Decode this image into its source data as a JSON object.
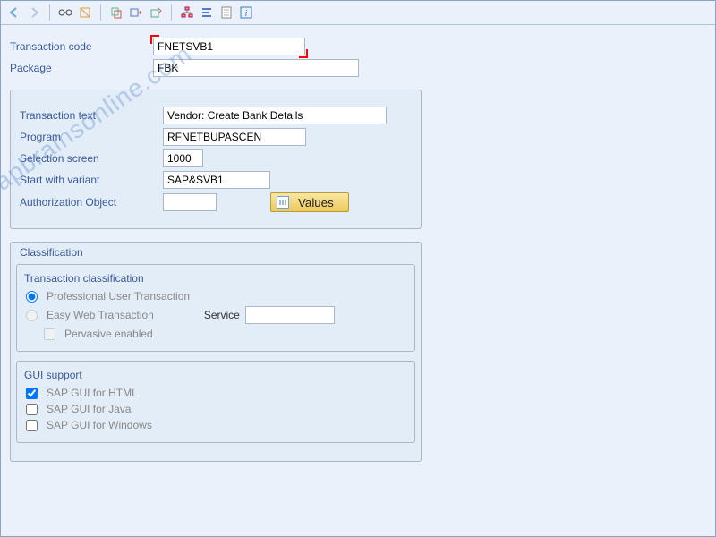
{
  "header": {
    "transaction_code_label": "Transaction code",
    "transaction_code_value": "FNETSVB1",
    "package_label": "Package",
    "package_value": "FBK"
  },
  "details": {
    "transaction_text_label": "Transaction text",
    "transaction_text_value": "Vendor: Create Bank Details",
    "program_label": "Program",
    "program_value": "RFNETBUPASCEN",
    "selection_screen_label": "Selection screen",
    "selection_screen_value": "1000",
    "start_variant_label": "Start with variant",
    "start_variant_value": "SAP&SVB1",
    "auth_object_label": "Authorization Object",
    "auth_object_value": "",
    "values_button": "Values"
  },
  "classification": {
    "title": "Classification",
    "transaction_classification": {
      "title": "Transaction classification",
      "opt_professional": "Professional User Transaction",
      "opt_easy_web": "Easy Web Transaction",
      "service_label": "Service",
      "service_value": "",
      "chk_pervasive": "Pervasive enabled"
    },
    "gui_support": {
      "title": "GUI support",
      "chk_html": "SAP GUI for HTML",
      "chk_java": "SAP GUI for Java",
      "chk_windows": "SAP GUI for Windows"
    }
  },
  "watermark": "sapbrainsonline.com"
}
